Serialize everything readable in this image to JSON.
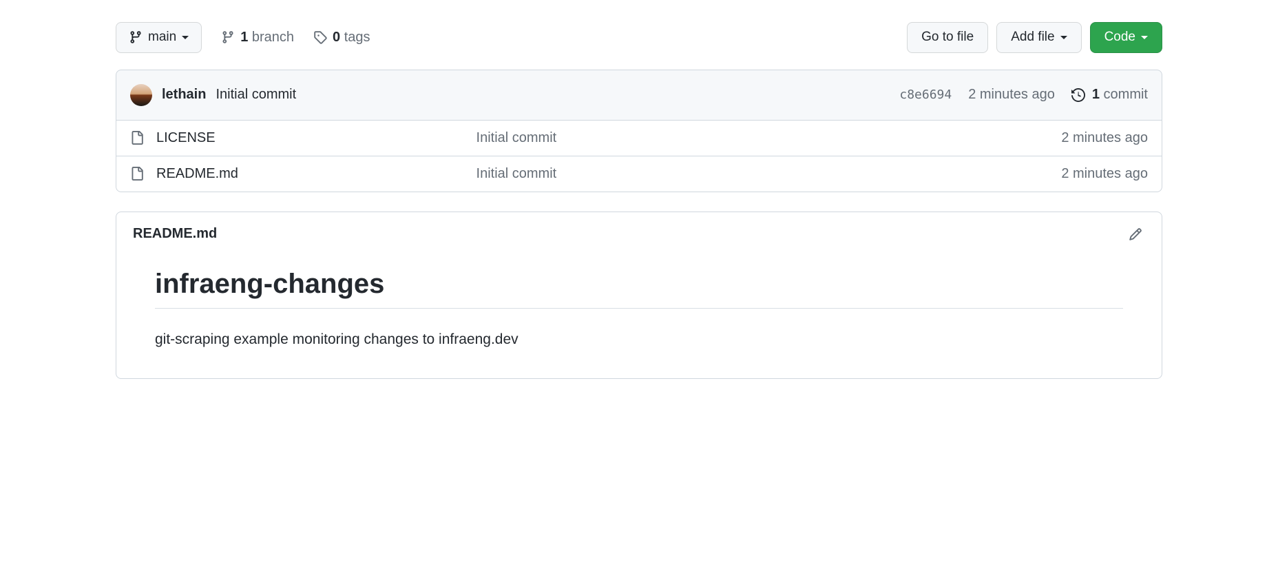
{
  "branch": {
    "current": "main"
  },
  "stats": {
    "branch_count": "1",
    "branch_label": "branch",
    "tag_count": "0",
    "tag_label": "tags"
  },
  "actions": {
    "go_to_file": "Go to file",
    "add_file": "Add file",
    "code": "Code"
  },
  "latest_commit": {
    "author": "lethain",
    "message": "Initial commit",
    "sha": "c8e6694",
    "time": "2 minutes ago",
    "commit_count": "1",
    "commit_label": "commit"
  },
  "files": [
    {
      "name": "LICENSE",
      "message": "Initial commit",
      "time": "2 minutes ago"
    },
    {
      "name": "README.md",
      "message": "Initial commit",
      "time": "2 minutes ago"
    }
  ],
  "readme": {
    "filename": "README.md",
    "heading": "infraeng-changes",
    "body": "git-scraping example monitoring changes to infraeng.dev"
  }
}
